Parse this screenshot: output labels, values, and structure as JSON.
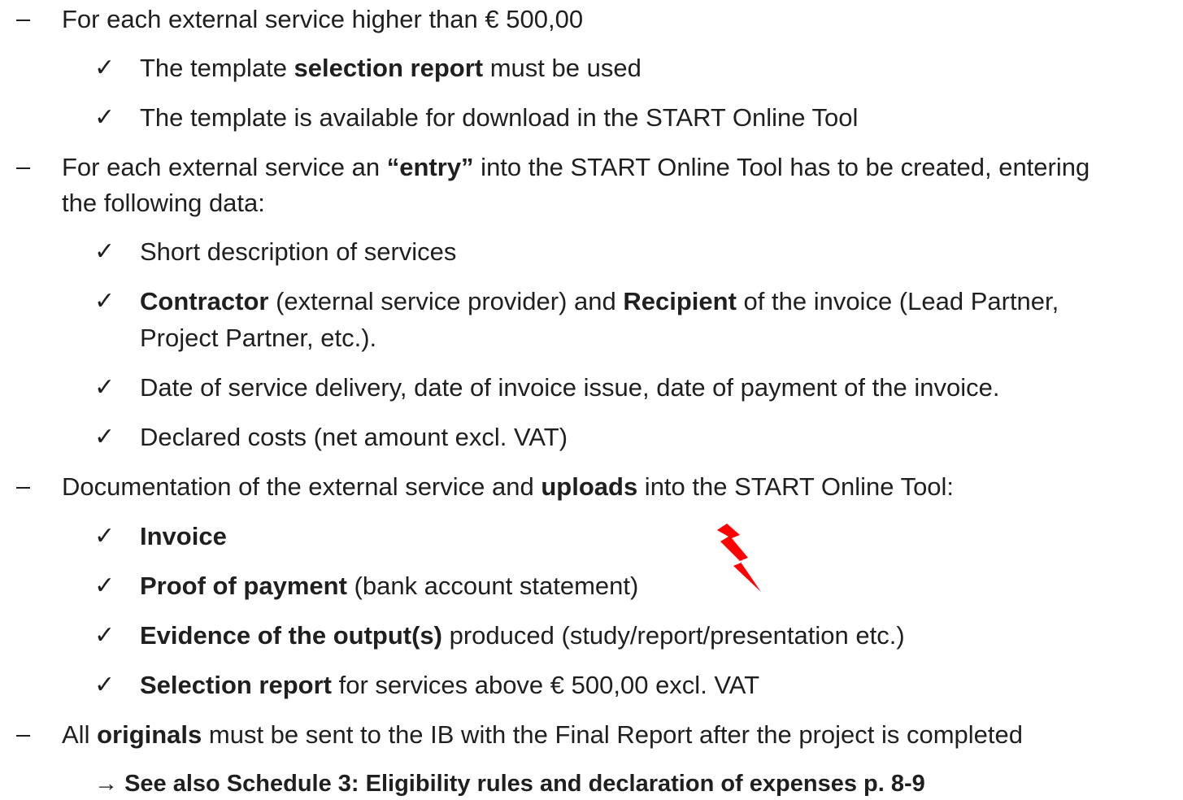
{
  "items": [
    {
      "level": 1,
      "parts": [
        {
          "t": "For each external service higher than € 500,00",
          "b": false
        }
      ]
    },
    {
      "level": 2,
      "parts": [
        {
          "t": "The template ",
          "b": false
        },
        {
          "t": "selection report",
          "b": true
        },
        {
          "t": "  must be used",
          "b": false
        }
      ]
    },
    {
      "level": 2,
      "parts": [
        {
          "t": "The template is available for download in the START Online Tool",
          "b": false
        }
      ]
    },
    {
      "level": 1,
      "parts": [
        {
          "t": "For each external service an ",
          "b": false
        },
        {
          "t": "“entry”",
          "b": true
        },
        {
          "t": " into the START Online Tool has to be created, entering",
          "b": false
        }
      ],
      "continuation": "the following data:"
    },
    {
      "level": 2,
      "parts": [
        {
          "t": "Short description of services",
          "b": false
        }
      ]
    },
    {
      "level": 2,
      "parts": [
        {
          "t": "Contractor",
          "b": true
        },
        {
          "t": " (external service provider) and ",
          "b": false
        },
        {
          "t": "Recipient",
          "b": true
        },
        {
          "t": " of the invoice (Lead Partner,",
          "b": false
        }
      ],
      "continuation": "Project Partner, etc.)."
    },
    {
      "level": 2,
      "parts": [
        {
          "t": "Date of service delivery, date of invoice issue, date of payment of the invoice.",
          "b": false
        }
      ]
    },
    {
      "level": 2,
      "parts": [
        {
          "t": "Declared costs (net amount excl. VAT)",
          "b": false
        }
      ]
    },
    {
      "level": 1,
      "parts": [
        {
          "t": "Documentation of the external service and ",
          "b": false
        },
        {
          "t": "uploads",
          "b": true
        },
        {
          "t": " into the START Online Tool:",
          "b": false
        }
      ]
    },
    {
      "level": 2,
      "parts": [
        {
          "t": "Invoice",
          "b": true
        }
      ]
    },
    {
      "level": 2,
      "parts": [
        {
          "t": "Proof of payment",
          "b": true
        },
        {
          "t": " (bank account statement)",
          "b": false
        }
      ]
    },
    {
      "level": 2,
      "parts": [
        {
          "t": "Evidence of the output(s)",
          "b": true
        },
        {
          "t": " produced (study/report/presentation etc.)",
          "b": false
        }
      ]
    },
    {
      "level": 2,
      "parts": [
        {
          "t": "Selection report",
          "b": true
        },
        {
          "t": " for services above € 500,00  excl. VAT",
          "b": false
        }
      ]
    },
    {
      "level": 1,
      "parts": [
        {
          "t": "All ",
          "b": false
        },
        {
          "t": "originals",
          "b": true
        },
        {
          "t": " must be sent to the IB with the Final Report after the project is completed",
          "b": false
        }
      ]
    }
  ],
  "footer_arrow": "→",
  "footer_text": "See also Schedule 3: Eligibility rules and declaration of expenses p. 8-9",
  "bullet_check": "✓",
  "accent_red": "#ff0000"
}
